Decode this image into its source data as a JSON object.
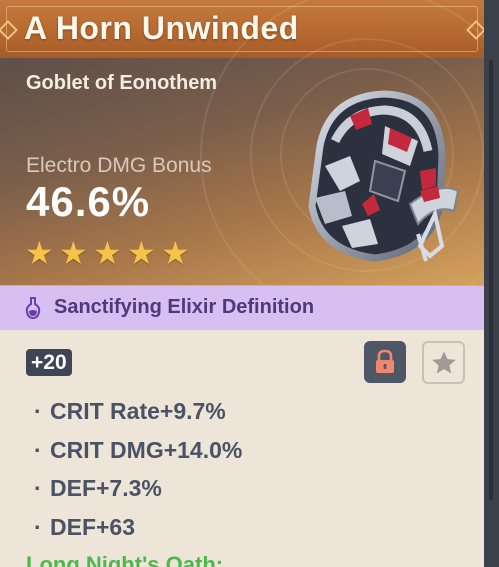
{
  "artifact": {
    "name": "A Horn Unwinded",
    "type": "Goblet of Eonothem",
    "main_stat": {
      "name": "Electro DMG Bonus",
      "value": "46.6%"
    },
    "rarity_stars": 5,
    "set_name": "Sanctifying Elixir Definition",
    "level": "+20",
    "substats": [
      {
        "bullet": "·",
        "text": "CRIT Rate+9.7%"
      },
      {
        "bullet": "·",
        "text": "CRIT DMG+14.0%"
      },
      {
        "bullet": "·",
        "text": "DEF+7.3%"
      },
      {
        "bullet": "·",
        "text": "DEF+63"
      }
    ],
    "set_bonus_title": "Long Night's Oath:"
  },
  "icons": {
    "lock": "lock-icon",
    "favorite": "star-icon",
    "set": "elixir-flask-icon",
    "rarity": "star-icon"
  },
  "colors": {
    "title_bar": "#b66a31",
    "star": "#f7c24a",
    "set_bar": "#d8bff2",
    "set_text": "#4d3a7a",
    "lock": "#f08870",
    "bonus_text": "#4bb84b"
  }
}
